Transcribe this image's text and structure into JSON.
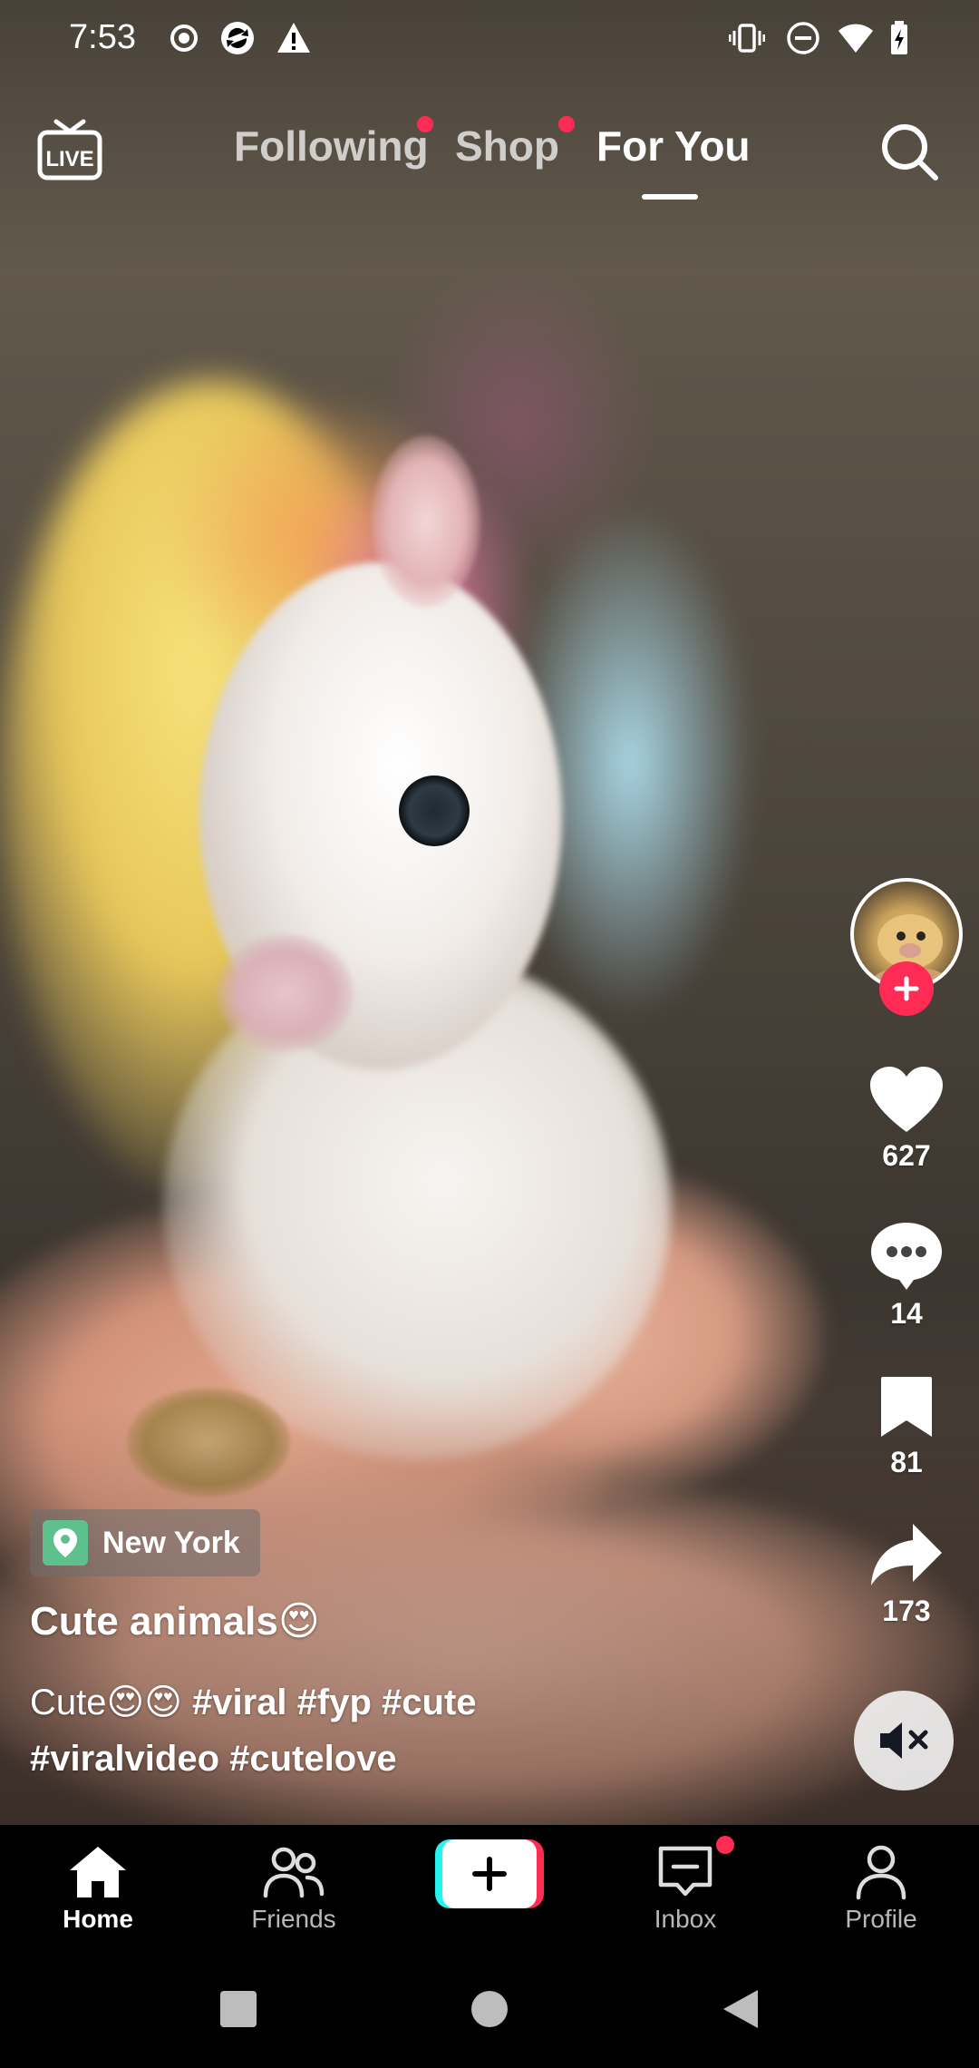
{
  "status_bar": {
    "time": "7:53",
    "left_icons": [
      "record-icon",
      "sync-app-icon",
      "warning-icon"
    ],
    "right_icons": [
      "vibrate-icon",
      "do-not-disturb-icon",
      "wifi-icon",
      "battery-charging-icon"
    ]
  },
  "top_nav": {
    "live_icon": "live-icon",
    "tabs": [
      {
        "label": "Following",
        "has_dot": true,
        "active": false
      },
      {
        "label": "Shop",
        "has_dot": true,
        "active": false
      },
      {
        "label": "For You",
        "has_dot": false,
        "active": true
      }
    ],
    "search_icon": "search-icon"
  },
  "video": {
    "location": "New York",
    "title": "Cute animals😍",
    "description_plain": "Cute😍😍 ",
    "hashtags_line1": "#viral #fyp #cute",
    "hashtags_line2": "#viralvideo #cutelove"
  },
  "actions": {
    "likes": "627",
    "comments": "14",
    "saves": "81",
    "shares": "173",
    "muted": true
  },
  "bottom_nav": {
    "items": [
      {
        "label": "Home",
        "icon": "home-icon",
        "active": true
      },
      {
        "label": "Friends",
        "icon": "friends-icon",
        "active": false
      },
      {
        "label": "",
        "icon": "create-icon",
        "active": false
      },
      {
        "label": "Inbox",
        "icon": "inbox-icon",
        "active": false,
        "has_dot": true
      },
      {
        "label": "Profile",
        "icon": "profile-icon",
        "active": false
      }
    ]
  },
  "colors": {
    "accent_red": "#fe2c55",
    "accent_cyan": "#25f4ee",
    "location_green": "#5ec08c"
  }
}
